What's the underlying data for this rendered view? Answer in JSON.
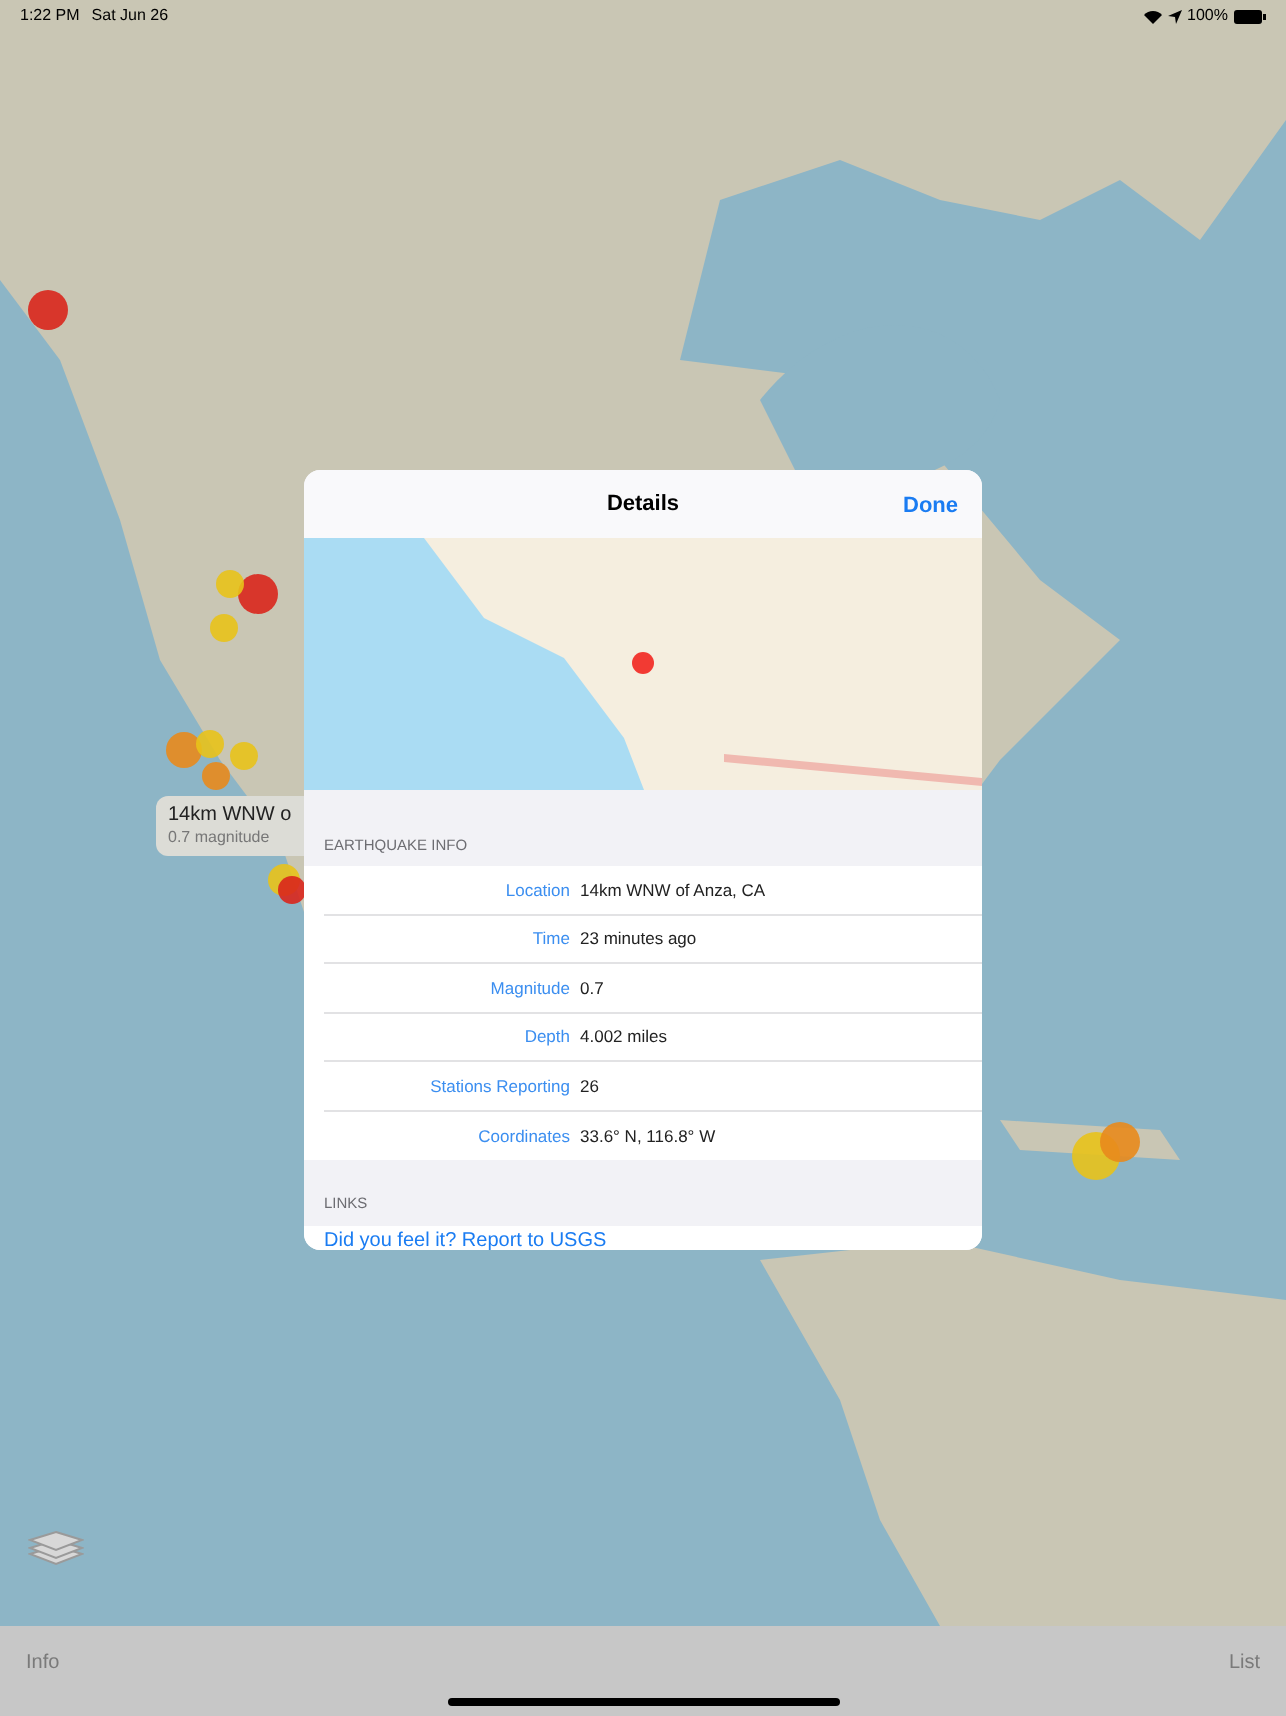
{
  "status_bar": {
    "time": "1:22 PM",
    "date": "Sat Jun 26",
    "battery": "100%"
  },
  "callout": {
    "title": "14km WNW o",
    "subtitle": "0.7 magnitude"
  },
  "details": {
    "title": "Details",
    "done": "Done",
    "info_header": "EARTHQUAKE INFO",
    "rows": [
      {
        "label": "Location",
        "value": "14km WNW of Anza, CA"
      },
      {
        "label": "Time",
        "value": "23 minutes ago"
      },
      {
        "label": "Magnitude",
        "value": "0.7"
      },
      {
        "label": "Depth",
        "value": "4.002 miles"
      },
      {
        "label": "Stations Reporting",
        "value": "26"
      },
      {
        "label": "Coordinates",
        "value": "33.6° N, 116.8° W"
      }
    ],
    "links_header": "LINKS",
    "link": "Did you feel it? Report to USGS"
  },
  "toolbar": {
    "left": "Info",
    "right": "List"
  }
}
